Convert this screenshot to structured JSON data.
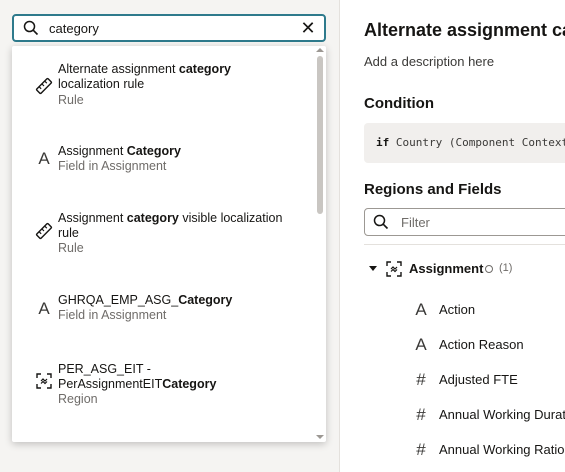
{
  "search": {
    "value": "category",
    "clear_glyph": "✕"
  },
  "results": [
    {
      "icon": "ruler-icon",
      "pre": "Alternate assignment ",
      "bold": "category",
      "post": " localization rule",
      "subtitle": "Rule"
    },
    {
      "icon": "letter-a-icon",
      "glyph": "A",
      "pre": "Assignment ",
      "bold": "Category",
      "post": "",
      "subtitle": "Field in Assignment"
    },
    {
      "icon": "ruler-icon",
      "pre": "Assignment ",
      "bold": "category",
      "post": " visible localization rule",
      "subtitle": "Rule"
    },
    {
      "icon": "letter-a-icon",
      "glyph": "A",
      "pre": "GHRQA_EMP_ASG_",
      "bold": "Category",
      "post": "",
      "subtitle": "Field in Assignment"
    },
    {
      "icon": "region-icon",
      "pre": "PER_ASG_EIT - PerAssignmentEIT",
      "bold": "Category",
      "post": "",
      "subtitle": "Region"
    }
  ],
  "panel": {
    "title": "Alternate assignment category localization rule",
    "description": "Add a description here",
    "condition_heading": "Condition",
    "condition_keyword": "if",
    "condition_text": "Country (Component Context) = ",
    "regions_heading": "Regions and Fields",
    "filter_placeholder": "Filter",
    "tree_parent": {
      "label": "Assignment",
      "count": "(1)"
    },
    "fields": [
      {
        "icon": "letter-a-icon",
        "glyph": "A",
        "label": "Action"
      },
      {
        "icon": "letter-a-icon",
        "glyph": "A",
        "label": "Action Reason"
      },
      {
        "icon": "hash-icon",
        "glyph": "#",
        "label": "Adjusted FTE"
      },
      {
        "icon": "hash-icon",
        "glyph": "#",
        "label": "Annual Working Duration"
      },
      {
        "icon": "hash-icon",
        "glyph": "#",
        "label": "Annual Working Ratio"
      }
    ]
  },
  "colors": {
    "search_border": "#2e7a8c",
    "text": "#161513",
    "muted": "#6f6c69"
  }
}
